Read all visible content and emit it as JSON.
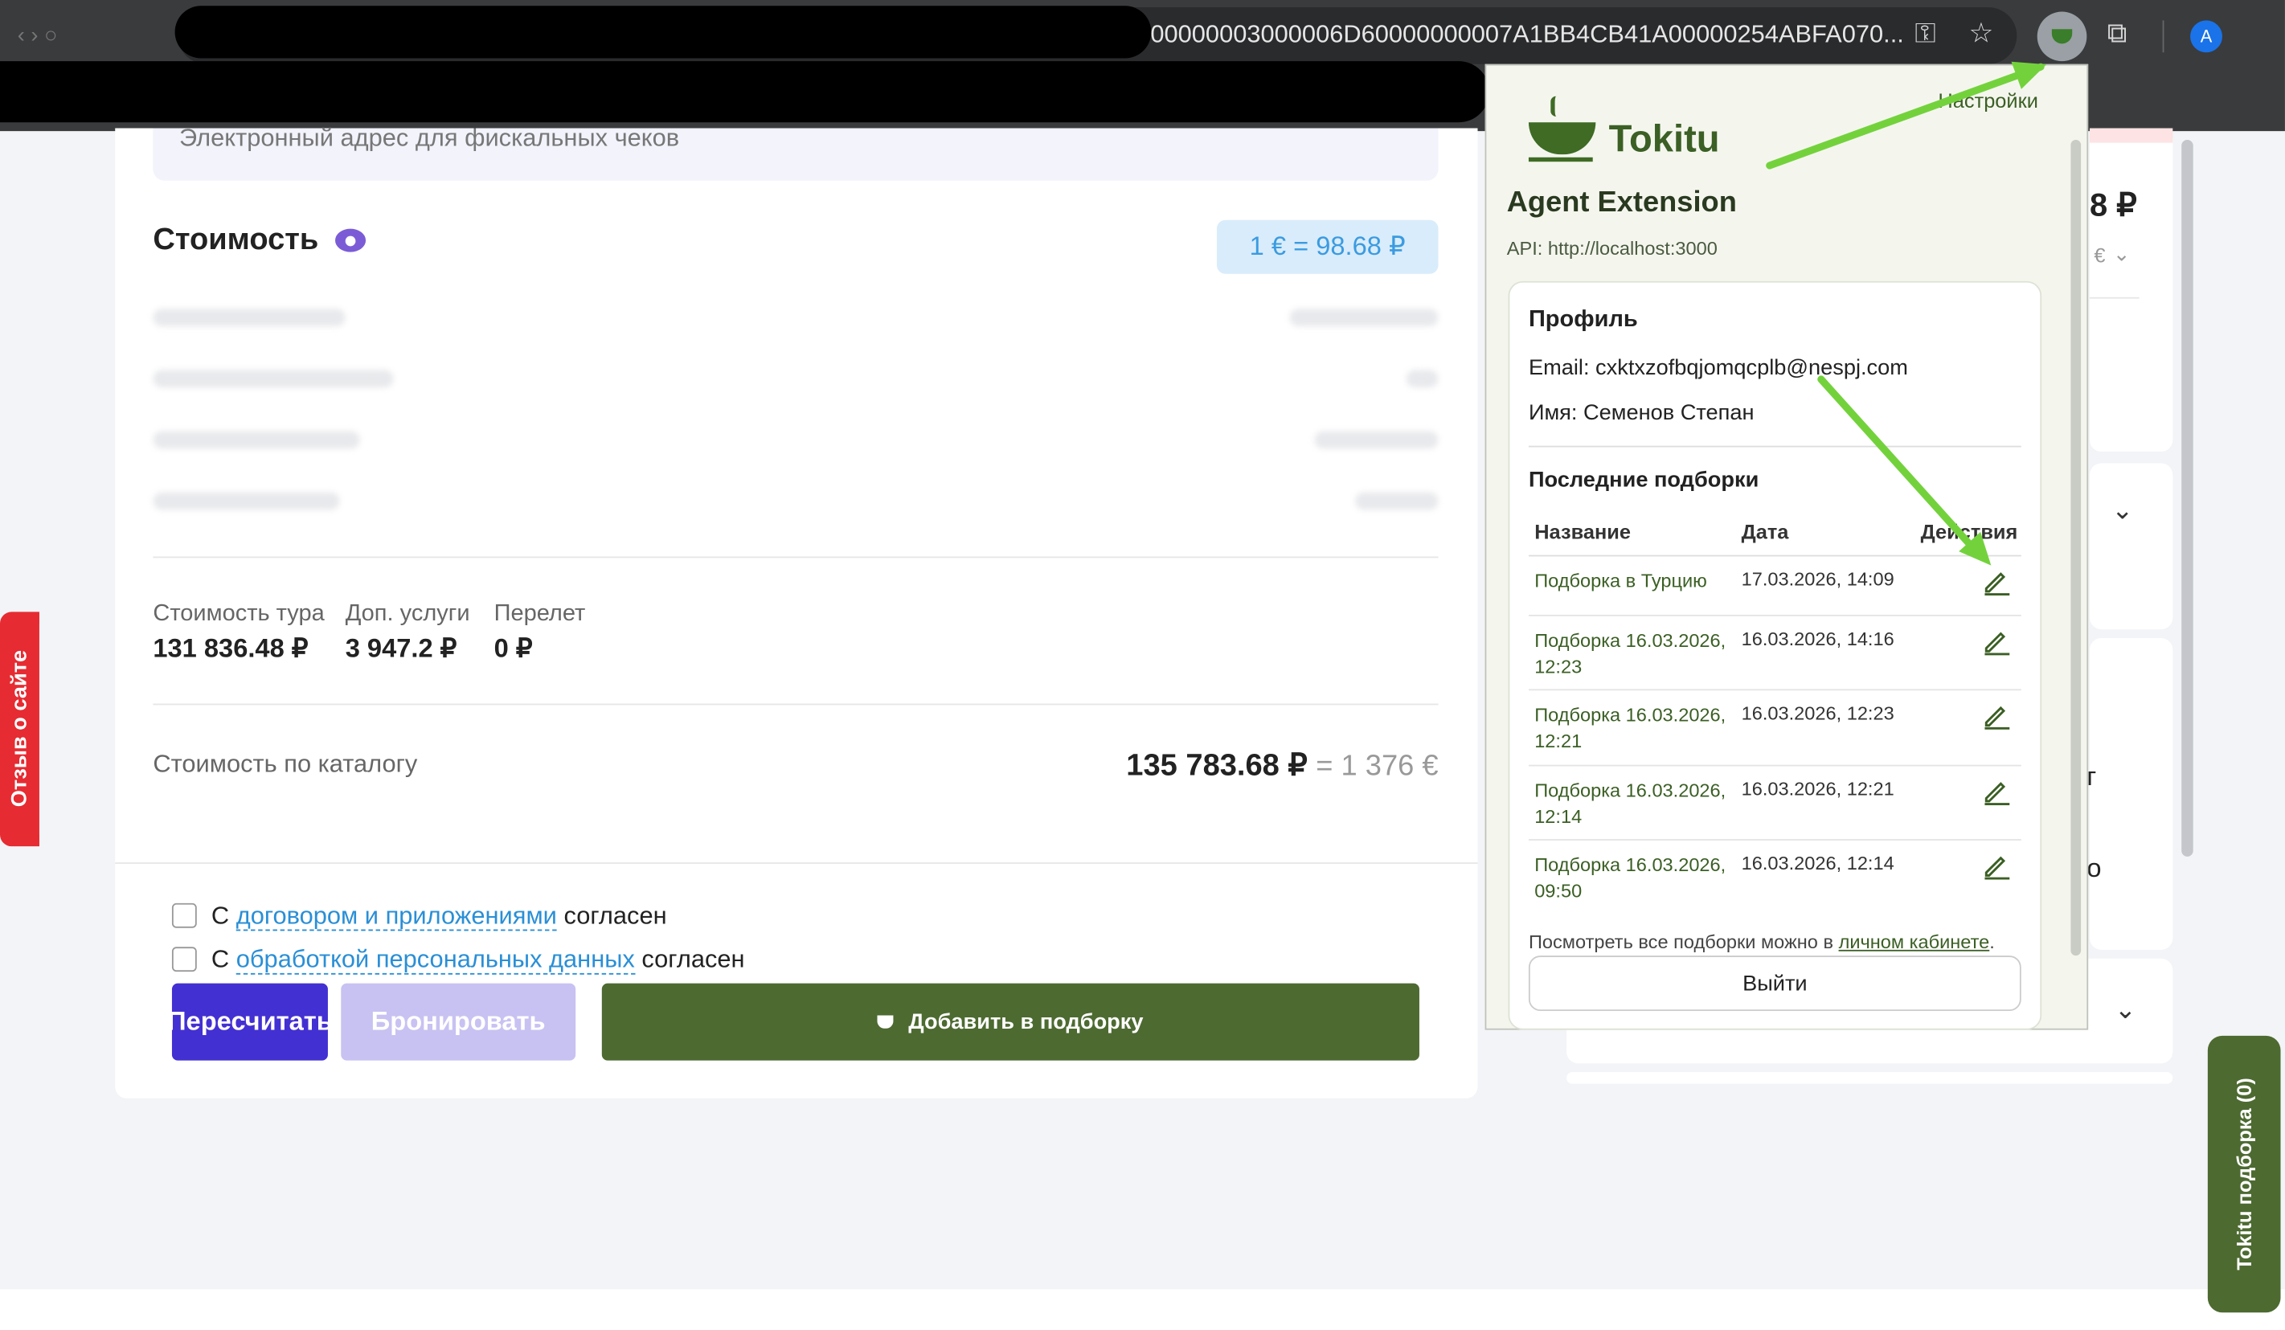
{
  "browser": {
    "url_visible": "200000003000006D60000000007A1BB4CB41A00000254ABFA070...",
    "avatar_letter": "A"
  },
  "page": {
    "email_receipt_placeholder": "Электронный адрес для фискальных чеков",
    "cost_title": "Стоимость",
    "exchange_rate": "1 € = 98.68 ₽",
    "tour_cost_label": "Стоимость тура",
    "tour_cost_value": "131 836.48 ₽",
    "extra_services_label": "Доп. услуги",
    "extra_services_value": "3 947.2 ₽",
    "flight_label": "Перелет",
    "flight_value": "0 ₽",
    "catalog_label": "Стоимость по каталогу",
    "catalog_value_rub": "135 783.68 ₽",
    "catalog_value_eur": "= 1 376 €",
    "agree1_prefix": "С",
    "agree1_link": "договором и приложениями",
    "agree1_suffix": "согласен",
    "agree2_prefix": "С",
    "agree2_link": "обработкой персональных данных",
    "agree2_suffix": "согласен",
    "recalc_button": "Пересчитать",
    "book_button": "Бронировать",
    "add_to_selection_button": "Добавить в подборку",
    "feedback_tab": "Отзыв о сайте",
    "tokitu_tab": "Tokitu подборка (0)",
    "right_price_partial": "8 ₽",
    "right_currency_partial": "€",
    "right_text_partial_1": "г",
    "right_text_partial_2": "о"
  },
  "popup": {
    "settings_link": "Настройки",
    "brand": "Tokitu",
    "subtitle": "Agent Extension",
    "api": "API: http://localhost:3000",
    "profile_title": "Профиль",
    "email": "Email: cxktxzofbqjomqcplb@nespj.com",
    "name": "Имя: Семенов Степан",
    "recent_title": "Последние подборки",
    "col_name": "Название",
    "col_date": "Дата",
    "col_actions": "Действия",
    "rows": [
      {
        "name": "Подборка в Турцию",
        "date": "17.03.2026, 14:09"
      },
      {
        "name": "Подборка 16.03.2026, 12:23",
        "date": "16.03.2026, 14:16"
      },
      {
        "name": "Подборка 16.03.2026, 12:21",
        "date": "16.03.2026, 12:23"
      },
      {
        "name": "Подборка 16.03.2026, 12:14",
        "date": "16.03.2026, 12:21"
      },
      {
        "name": "Подборка 16.03.2026, 09:50",
        "date": "16.03.2026, 12:14"
      }
    ],
    "view_all_prefix": "Посмотреть все подборки можно в",
    "view_all_link": "личном кабинете",
    "view_all_suffix": ".",
    "logout_button": "Выйти"
  },
  "colors": {
    "accent_green": "#4d6a31",
    "primary_purple": "#4330d2",
    "annotation_arrow": "#73d23c"
  }
}
